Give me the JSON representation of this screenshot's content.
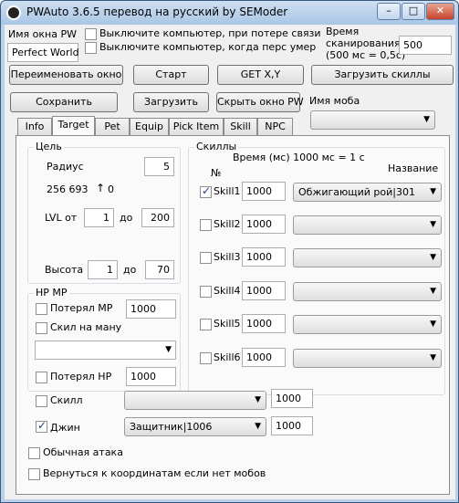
{
  "window": {
    "title": "PWAuto 3.6.5 перевод на русский by SEModer",
    "minimize": "–",
    "maximize": "□",
    "close": "✕"
  },
  "top": {
    "pw_window_label": "Имя окна PW",
    "pw_window_value": "Perfect World",
    "shutdown_disconnect": "Выключите компьютер, при потере связи",
    "shutdown_death": "Выключите компьютер, когда перс умер",
    "scan_time_label_1": "Время",
    "scan_time_label_2": "сканирования",
    "scan_time_label_3": "(500 мс = 0,5с)",
    "scan_time_value": "500"
  },
  "buttons": {
    "rename_window": "Переименовать окно",
    "start": "Старт",
    "get_xy": "GET X,Y",
    "load_skills": "Загрузить скиллы",
    "save": "Сохранить",
    "load": "Загрузить",
    "hide_pw": "Скрыть окно PW"
  },
  "mob_name_label": "Имя моба",
  "mob_name_value": "",
  "tabs": [
    "Info",
    "Target",
    "Pet",
    "Equip",
    "Pick Item",
    "Skill",
    "NPC"
  ],
  "target": {
    "group_title": "Цель",
    "radius_label": "Радиус",
    "radius_value": "5",
    "coords": "256 693",
    "arrow": "↑",
    "zero": "0",
    "lvl_from_label": "LVL от",
    "lvl_from": "1",
    "lvl_to_label": "до",
    "lvl_to": "200",
    "height_label": "Высота",
    "height_from": "1",
    "height_to_label": "до",
    "height_to": "70"
  },
  "hpmp": {
    "group_title": "HP MP",
    "lost_mp_label": "Потерял MP",
    "lost_mp_value": "1000",
    "skill_mana_label": "Скил на ману",
    "skill_mana_select": "",
    "lost_hp_label": "Потерял HP",
    "lost_hp_value": "1000"
  },
  "skills": {
    "group_title": "Скиллы",
    "time_note": "Время (мс) 1000 мс = 1 с",
    "num_header": "№",
    "name_header": "Название",
    "rows": [
      {
        "label": "Skill1",
        "checked": true,
        "time": "1000",
        "name": "Обжигающий рой|301"
      },
      {
        "label": "Skill2",
        "checked": false,
        "time": "1000",
        "name": ""
      },
      {
        "label": "Skill3",
        "checked": false,
        "time": "1000",
        "name": ""
      },
      {
        "label": "Skill4",
        "checked": false,
        "time": "1000",
        "name": ""
      },
      {
        "label": "Skill5",
        "checked": false,
        "time": "1000",
        "name": ""
      },
      {
        "label": "Skill6",
        "checked": false,
        "time": "1000",
        "name": ""
      }
    ]
  },
  "bottom": {
    "skill_label": "Скилл",
    "skill_select": "",
    "skill_value": "1000",
    "djinn_label": "Джин",
    "djinn_select": "Защитник|1006",
    "djinn_value": "1000",
    "plain_attack": "Обычная атака",
    "return_coords": "Вернуться к координатам если нет мобов"
  }
}
